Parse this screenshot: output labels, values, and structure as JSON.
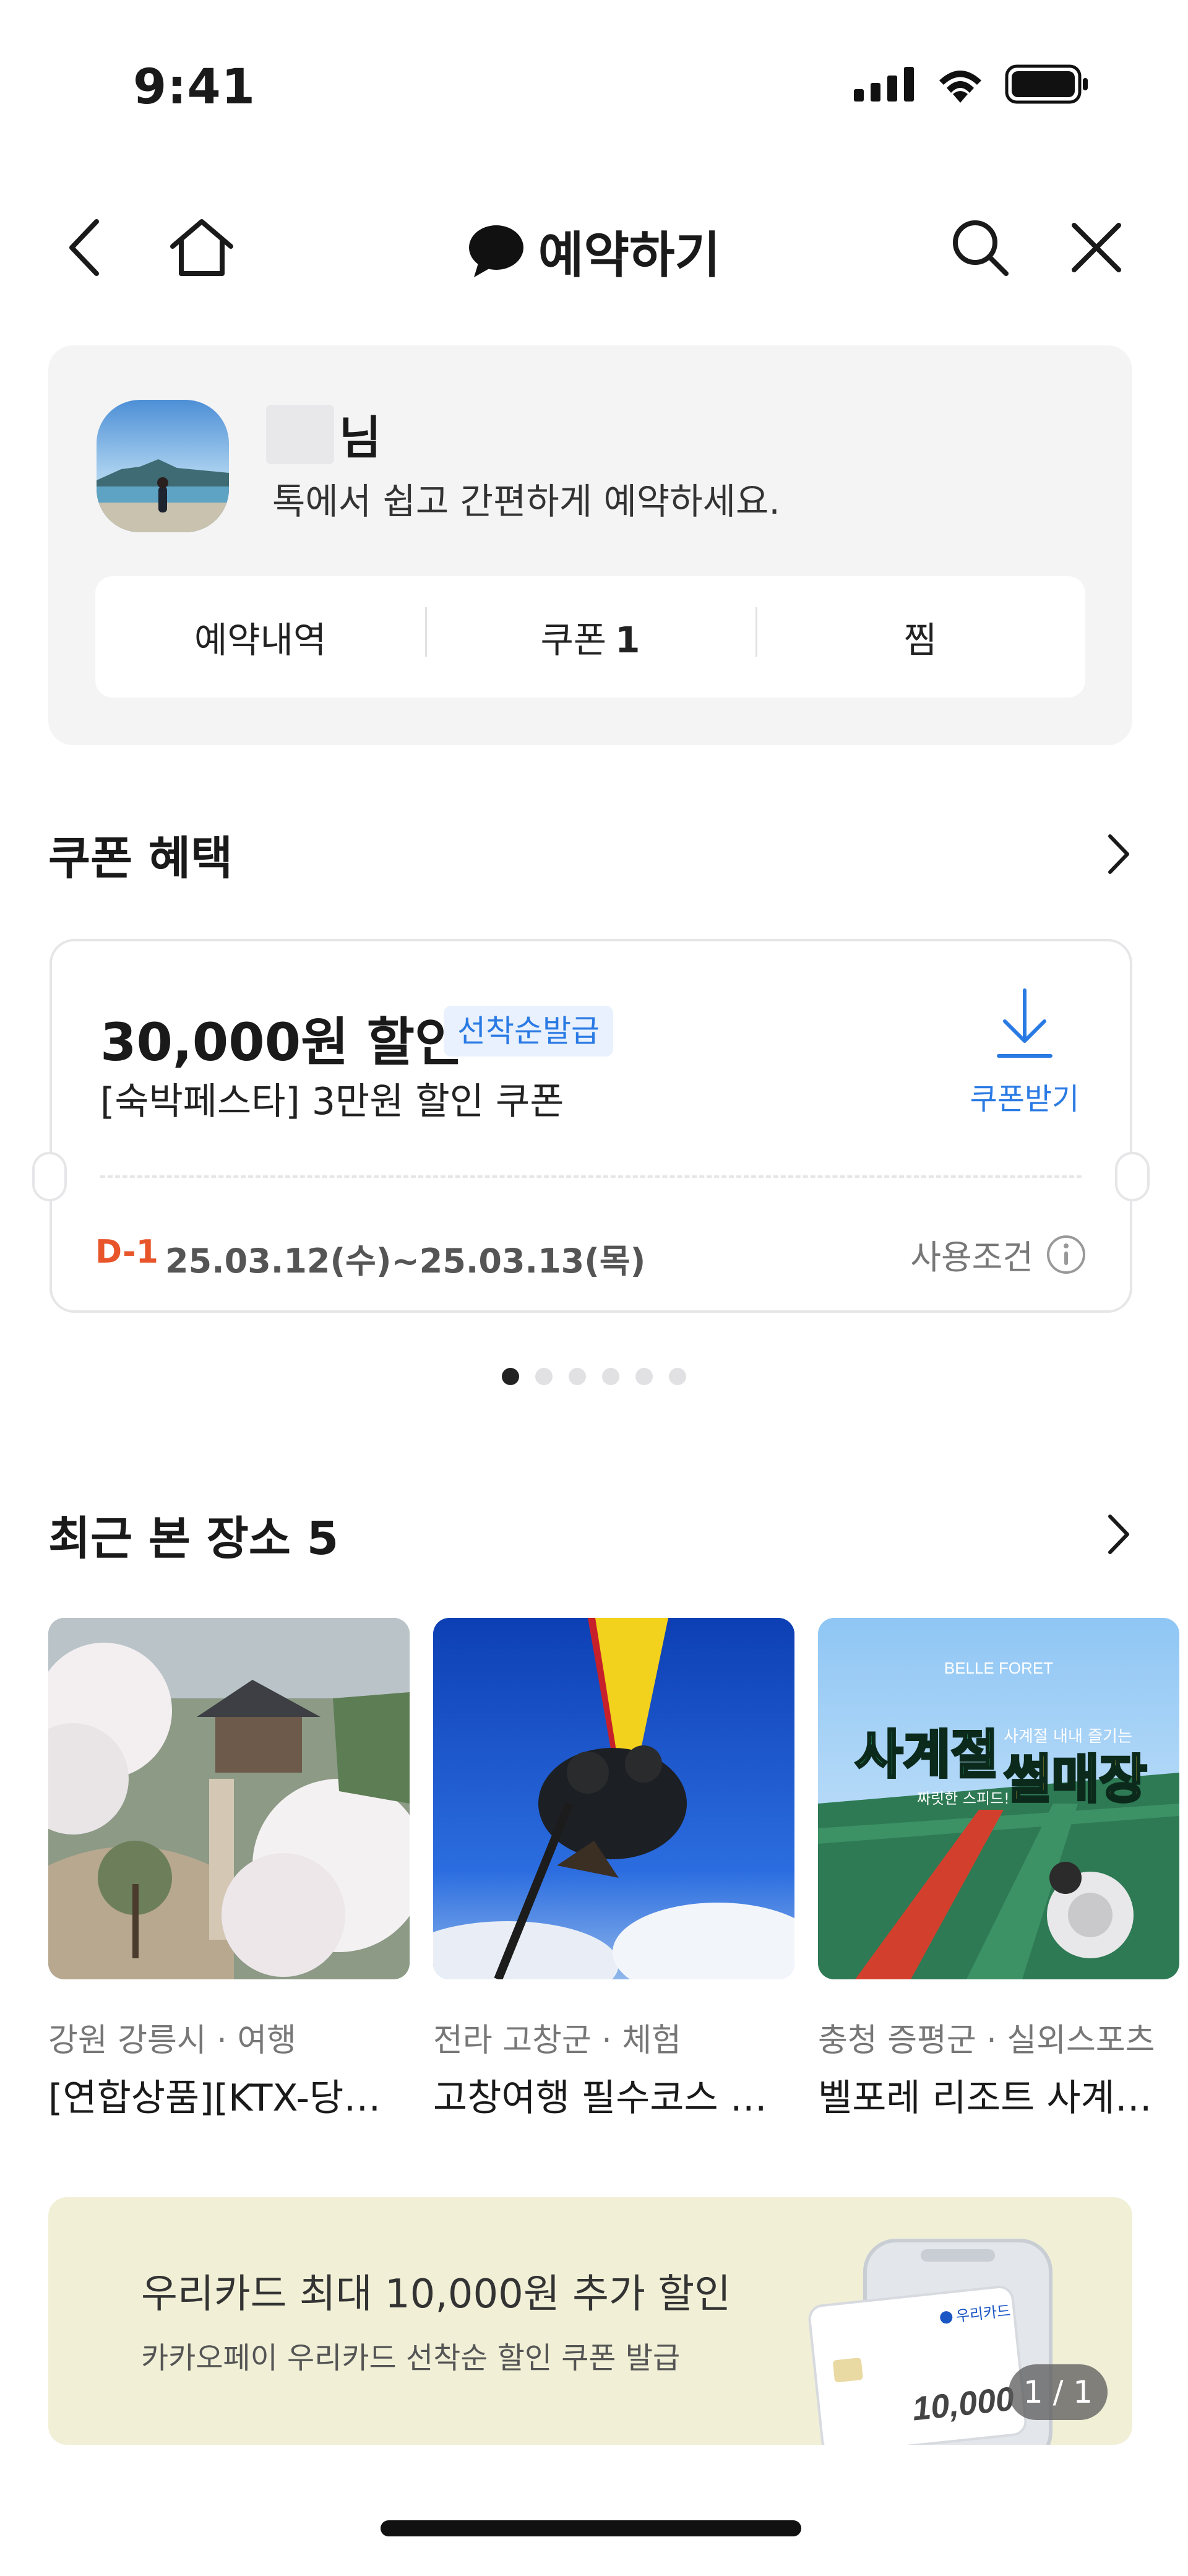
{
  "status_bar": {
    "time": "9:41"
  },
  "nav": {
    "title": "예약하기",
    "icons": [
      "back-arrow-icon",
      "home-icon",
      "chat-bubble-icon",
      "search-icon",
      "close-icon"
    ]
  },
  "profile": {
    "name_suffix": "님",
    "greeting": "톡에서 쉽고 간편하게 예약하세요.",
    "tabs": [
      {
        "label": "예약내역"
      },
      {
        "label": "쿠폰",
        "count": "1"
      },
      {
        "label": "찜"
      }
    ]
  },
  "coupon_section": {
    "title": "쿠폰 혜택",
    "coupon": {
      "amount": "30,000원 할인",
      "badge": "선착순발급",
      "name": "[숙박페스타] 3만원 할인 쿠폰",
      "download_label": "쿠폰받기",
      "dday": "D-1",
      "period": "25.03.12(수)~25.03.13(목)",
      "terms_label": "사용조건"
    },
    "pagination": {
      "total": 6,
      "active": 1
    }
  },
  "recent_section": {
    "title": "최근 본 장소 5",
    "items": [
      {
        "location": "강원 강릉시 · 여행",
        "title": "[연합상품][KTX-당일] 강릉 여행"
      },
      {
        "location": "전라 고창군 · 체험",
        "title": "고창여행 필수코스 패러글라이딩"
      },
      {
        "location": "충청 증평군 · 실외스포츠",
        "title": "벨포레 리조트 사계절 썰매장"
      }
    ],
    "thumb3": {
      "brand": "BELLE FORET",
      "headline_1": "사계절",
      "headline_2": "썰매장",
      "tag_1": "사계절 내내 즐기는",
      "tag_2": "짜릿한 스피드!"
    }
  },
  "banner": {
    "title": "우리카드 최대 10,000원 추가 할인",
    "subtitle": "카카오페이 우리카드 선착순 할인 쿠폰 발급",
    "card_brand": "우리카드",
    "card_amount": "10,000",
    "counter": "1 / 1"
  },
  "colors": {
    "accent_blue": "#2a7ae4",
    "dday_orange": "#e8552b",
    "card_bg": "#f4f4f5",
    "banner_bg": "#f1f0d7"
  }
}
